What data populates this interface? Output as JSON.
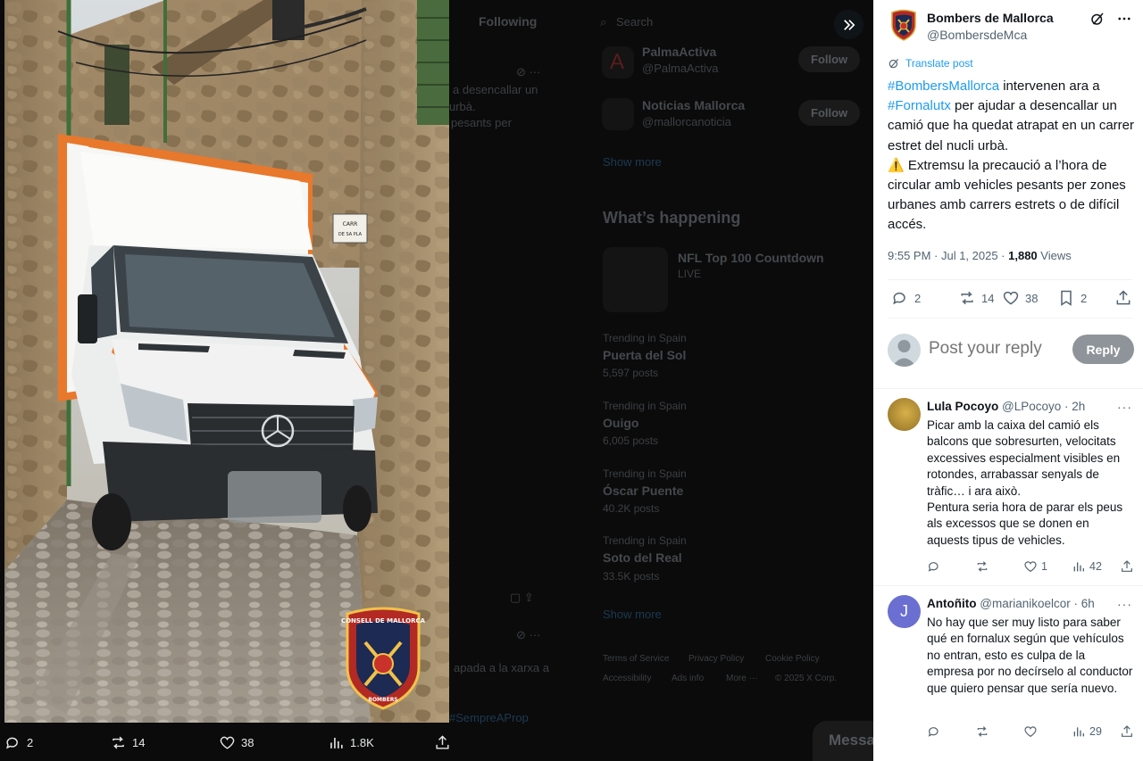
{
  "background": {
    "tab_following": "Following",
    "search_placeholder": "Search",
    "who_to_follow": [
      {
        "name": "PalmaActiva",
        "handle": "@PalmaActiva",
        "button": "Follow"
      },
      {
        "name": "Noticias Mallorca",
        "handle": "@mallorcanoticia",
        "button": "Follow"
      }
    ],
    "show_more": "Show more",
    "whats_happening": "What’s happening",
    "event": {
      "title": "NFL Top 100 Countdown",
      "status": "LIVE"
    },
    "trends": [
      {
        "context": "Trending in Spain",
        "name": "Puerta del Sol",
        "posts": "5,597 posts"
      },
      {
        "context": "Trending in Spain",
        "name": "Ouigo",
        "posts": "6,005 posts"
      },
      {
        "context": "Trending in Spain",
        "name": "Óscar Puente",
        "posts": "40.2K posts"
      },
      {
        "context": "Trending in Spain",
        "name": "Soto del Real",
        "posts": "33.5K posts"
      }
    ],
    "show_more_2": "Show more",
    "footer_links": [
      "Terms of Service",
      "Privacy Policy",
      "Cookie Policy",
      "Accessibility",
      "Ads info",
      "More ···",
      "© 2025 X Corp."
    ],
    "timeline_fragments": [
      "a desencallar un",
      "urbà.",
      "pesants per",
      "apada a la xarxa a",
      "#SempreAProp"
    ],
    "messages": "Messages"
  },
  "media_bar": {
    "replies": "2",
    "reposts": "14",
    "likes": "38",
    "views": "1.8K"
  },
  "media": {
    "street_sign": "CARRER DE SA PLAÇA",
    "badge_top": "CONSELL DE MALLORCA",
    "badge_bottom": "BOMBERS"
  },
  "post": {
    "author_name": "Bombers de Mallorca",
    "author_handle": "@BombersdeMca",
    "translate": "Translate post",
    "hashtag1": "#BombersMallorca",
    "text1": " intervenen ara a ",
    "hashtag2": "#Fornalutx",
    "text2": " per ajudar a desencallar un camió que ha quedat atrapat en un carrer estret del nucli urbà.",
    "warning_line": "⚠️ Extremsu la precaució a l’hora de circular amb vehicles pesants per zones urbanes amb carrers estrets o de difícil accés.",
    "time": "9:55 PM · Jul 1, 2025 · ",
    "views_count": "1,880",
    "views_label": " Views",
    "replies": "2",
    "reposts": "14",
    "likes": "38",
    "bookmarks": "2"
  },
  "reply_box": {
    "placeholder": "Post your reply",
    "button": "Reply"
  },
  "replies": [
    {
      "name": "Lula Pocoyo",
      "handle": "@LPocoyo",
      "time": " · 2h",
      "text": "Picar amb la caixa del camió els balcons que sobresurten, velocitats excessives especialment visibles en rotondes, arrabassar senyals de tràfic… i ara això.\n Pentura seria hora de parar els peus als excessos que se donen en aquests tipus de vehicles.",
      "likes": "1",
      "views": "42"
    },
    {
      "name": "Antoñito",
      "handle": "@marianikoelcor",
      "time": " · 6h",
      "avatar_letter": "J",
      "text": "No hay que ser muy listo para saber qué en fornalux según que vehículos no entran, esto es culpa de la empresa por no decírselo al conductor que quiero pensar que sería nuevo.",
      "views": "29"
    }
  ],
  "colors": {
    "accent": "#1d9bf0",
    "text": "#0f1419",
    "muted": "#536471",
    "reply_button": "#8e9499",
    "truck_orange": "#e8782c"
  }
}
